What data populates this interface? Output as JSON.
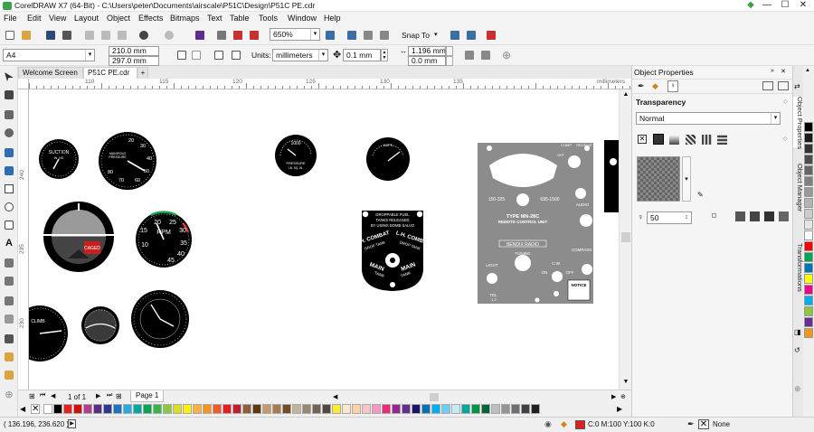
{
  "window": {
    "title": "CorelDRAW X7 (64-Bit) - C:\\Users\\peter\\Documents\\airscale\\P51C\\Design\\P51C PE.cdr",
    "min": "—",
    "max": "☐",
    "close": "✕"
  },
  "menu": [
    "File",
    "Edit",
    "View",
    "Layout",
    "Object",
    "Effects",
    "Bitmaps",
    "Text",
    "Table",
    "Tools",
    "Window",
    "Help"
  ],
  "toolbar": {
    "zoom": "650%",
    "snap_to": "Snap To",
    "icons": [
      "new-icon",
      "open-icon",
      "save-icon",
      "print-icon",
      "cut-icon",
      "copy-icon",
      "paste-icon",
      "undo-icon",
      "redo-icon",
      "search-content-icon",
      "import-icon",
      "export-icon",
      "publish-pdf-icon",
      "app-launcher-icon",
      "welcome-screen-icon",
      "full-screen-icon",
      "show-rulers-icon",
      "snap-icon",
      "options-icon",
      "launch-icon"
    ]
  },
  "propbar": {
    "paper": "A4",
    "width": "210.0 mm",
    "height": "297.0 mm",
    "units_label": "Units:",
    "units": "millimeters",
    "nudge": "0.1 mm",
    "dup_x": "1.196 mm",
    "dup_y": "0.0 mm"
  },
  "tabs": [
    {
      "label": "Welcome Screen",
      "active": false
    },
    {
      "label": "P51C PE.cdr",
      "active": true
    }
  ],
  "add_tab": "+",
  "ruler": {
    "h_labels": [
      "110",
      "115",
      "120",
      "125",
      "130",
      "135"
    ],
    "unit": "millimeters",
    "v_labels": [
      "240",
      "235",
      "230"
    ]
  },
  "canvas": {
    "gauges": {
      "suction": {
        "label": "SUCTION",
        "sub": "IN. HG"
      },
      "manifold": {
        "label": "MANIFOLD",
        "sub": "PRESSURE",
        "nums": [
          "20",
          "30",
          "40",
          "50",
          "60",
          "70",
          "80"
        ]
      },
      "attitude": {
        "caged": "CAGED"
      },
      "rpm": {
        "label": "RPM",
        "nums": [
          "20",
          "25",
          "30",
          "35",
          "15",
          "40",
          "10",
          "45"
        ]
      },
      "climb": {
        "label": "CLIMB"
      },
      "pressure": {
        "top": "1000",
        "label": "PRESSURE",
        "sub": "LB. SQ. IN."
      },
      "amps": {
        "label": "AMPS"
      }
    },
    "fuel_placard": {
      "head": "DROPPABLE FUEL TANKS RELEASED BY USING BOMB SALVO",
      "rh": "R.H. COMBAT",
      "lh": "L.H. COMBAT",
      "rh_sub": "DROP TANK",
      "lh_sub": "DROP TANK",
      "main_l": "MAIN",
      "main_r": "MAIN",
      "tank_l": "TANK",
      "tank_r": "TANK"
    },
    "radio_panel": {
      "comp": "COMP",
      "receive": "RECEIVE",
      "off": "OFF",
      "freq_l": "150-325",
      "freq_r": "695-1500",
      "audio": "AUDIO",
      "type": "TYPE MN-28C",
      "remote": "REMOTE CONTROL UNIT",
      "brand": "BENDIX RADIO",
      "tuning": "TUNING",
      "compass": "COMPASS",
      "light": "LIGHT",
      "cw": "C.W.",
      "on": "ON",
      "off2": "OFF",
      "tel": "TEL.",
      "tel_nums": "1   2",
      "notice": "NOTICE"
    }
  },
  "page_nav": {
    "counter": "1 of 1",
    "page_tab": "Page 1"
  },
  "status": {
    "coords": "( 136.196, 236.620 )",
    "fill": "C:0 M:100 Y:100 K:0",
    "outline": "None",
    "fill_color": "#e02020"
  },
  "docker": {
    "header": "Object Properties",
    "section": "Transparency",
    "mode": "Normal",
    "opacity": "50",
    "tabs": [
      "Object Properties",
      "Object Manager",
      "Transformations"
    ]
  },
  "palette": [
    "#ffffff",
    "#000000",
    "#e82020",
    "#cc1010",
    "#b43c8c",
    "#5a2d82",
    "#2b3990",
    "#1c75bc",
    "#27aae1",
    "#00a99d",
    "#00a651",
    "#39b54a",
    "#8dc63f",
    "#d7df23",
    "#fff200",
    "#fbb040",
    "#f7941d",
    "#f15a29",
    "#ed1c24",
    "#be1e2d",
    "#8b5e3c",
    "#603913",
    "#c49a6c",
    "#a97c50",
    "#754c24",
    "#c2b59b",
    "#998675",
    "#736357",
    "#534741",
    "#f9ed32",
    "#fde6cf",
    "#fbd1a7",
    "#f6c6c8",
    "#f49ac2",
    "#ee2a7b",
    "#92278f",
    "#662d91",
    "#1b1464",
    "#0072bc",
    "#00aeef",
    "#6dcff6",
    "#c7eafb",
    "#00a79d",
    "#009444",
    "#006838",
    "#bcbec0",
    "#939598",
    "#6d6e71",
    "#414042",
    "#231f20"
  ],
  "right_palette": [
    "#000000",
    "#1a1a1a",
    "#333333",
    "#4d4d4d",
    "#666666",
    "#808080",
    "#999999",
    "#b3b3b3",
    "#cccccc",
    "#e6e6e6",
    "#ffffff",
    "#ff0000",
    "#00a651",
    "#0072bc",
    "#ffff00",
    "#ec008c",
    "#00aeef",
    "#8dc63f",
    "#662d91",
    "#f7941d"
  ]
}
